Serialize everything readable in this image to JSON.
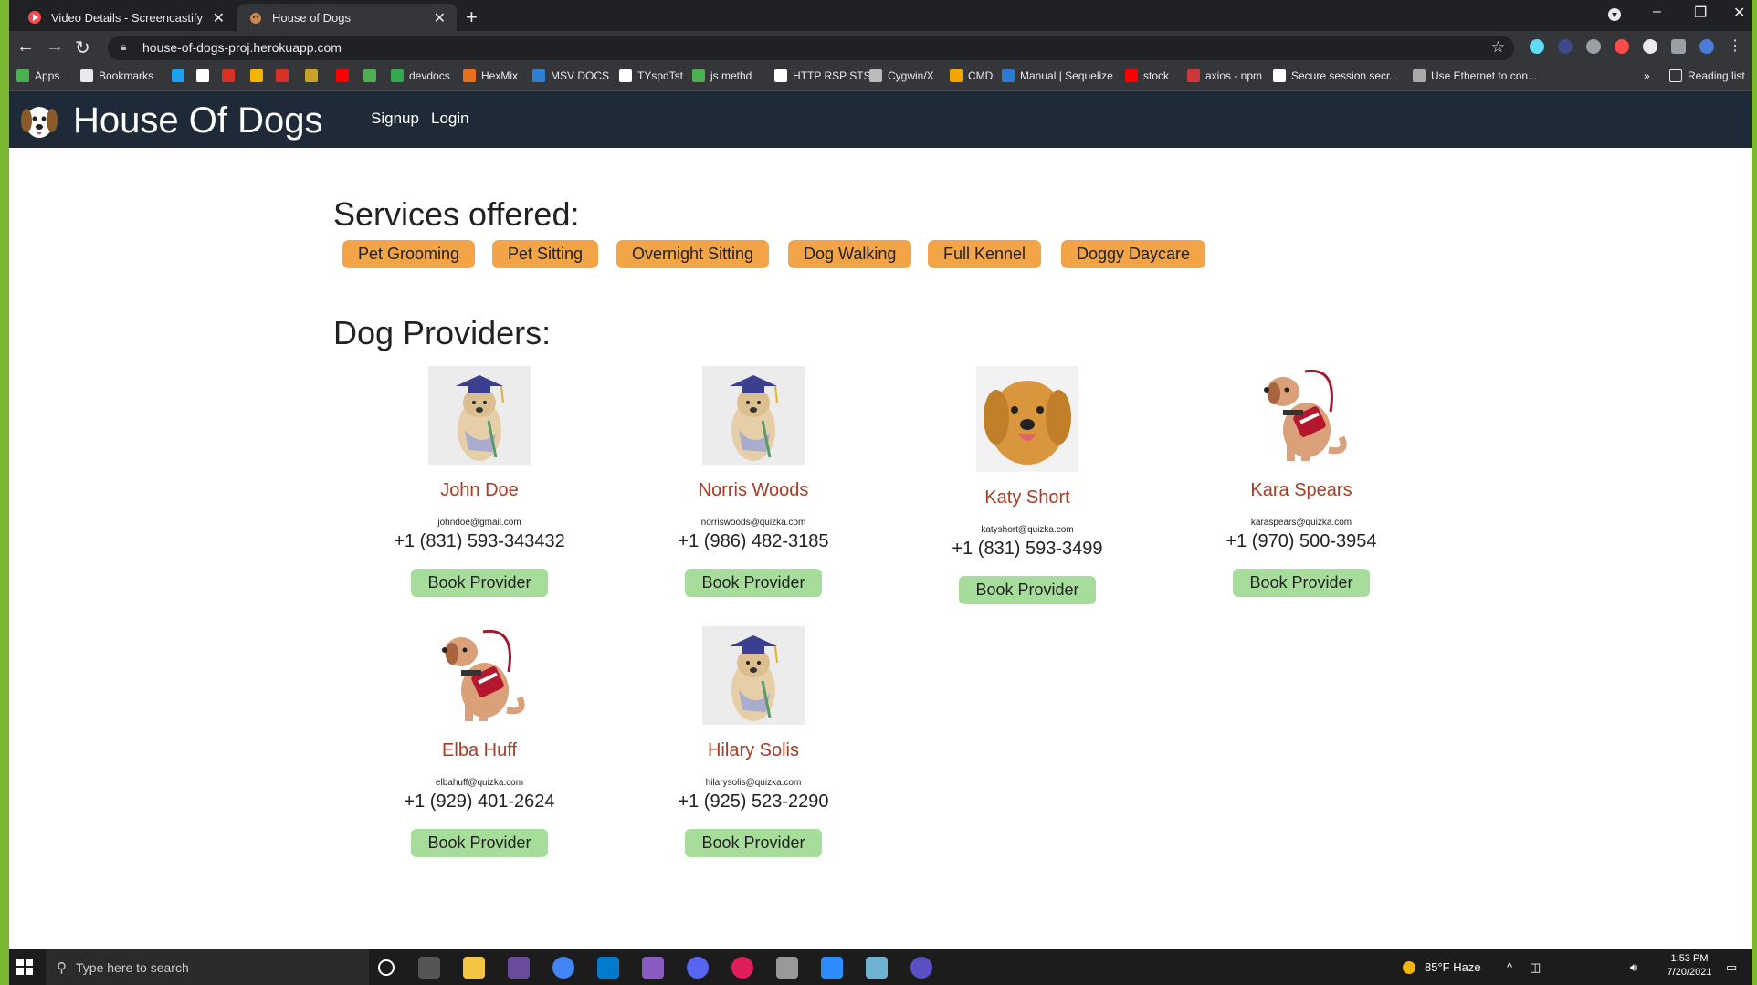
{
  "browser": {
    "tabs": [
      {
        "title": "Video Details - Screencastify",
        "close": "✕"
      },
      {
        "title": "House of Dogs",
        "close": "✕"
      }
    ],
    "new_tab": "+",
    "window_controls": {
      "minimize": "–",
      "restore": "❐",
      "close": "✕"
    },
    "url": "house-of-dogs-proj.herokuapp.com",
    "bookmarks": [
      {
        "label": "Apps",
        "color": "#4caf50"
      },
      {
        "label": "Bookmarks",
        "color": "#e8eaed"
      },
      {
        "label": "",
        "color": "#1da1f2"
      },
      {
        "label": "",
        "color": "#ffffff"
      },
      {
        "label": "",
        "color": "#d93025"
      },
      {
        "label": "",
        "color": "#f4b400"
      },
      {
        "label": "",
        "color": "#d93025"
      },
      {
        "label": "",
        "color": "#c9a227"
      },
      {
        "label": "",
        "color": "#ff0000"
      },
      {
        "label": "",
        "color": "#4caf50"
      },
      {
        "label": "devdocs",
        "color": "#34a853"
      },
      {
        "label": "HexMix",
        "color": "#e8711a"
      },
      {
        "label": "MSV DOCS",
        "color": "#2d7fd3"
      },
      {
        "label": "TYspdTst",
        "color": "#ffffff"
      },
      {
        "label": "js methd",
        "color": "#4caf50"
      },
      {
        "label": "HTTP RSP STS",
        "color": "#ffffff"
      },
      {
        "label": "Cygwin/X",
        "color": "#bbbbbb"
      },
      {
        "label": "CMD",
        "color": "#f4a300"
      },
      {
        "label": "Manual | Sequelize",
        "color": "#2b7bd3"
      },
      {
        "label": "stock",
        "color": "#ff0000"
      },
      {
        "label": "axios - npm",
        "color": "#cb3837"
      },
      {
        "label": "Secure session secr...",
        "color": "#ffffff"
      },
      {
        "label": "Use Ethernet to con...",
        "color": "#aaaaaa"
      }
    ],
    "bookmarks_more": "»",
    "reading_list": "Reading list"
  },
  "site": {
    "brand": "House Of Dogs",
    "nav": [
      {
        "label": "Signup"
      },
      {
        "label": "Login"
      }
    ],
    "services_title": "Services offered:",
    "services": [
      "Pet Grooming",
      "Pet Sitting",
      "Overnight Sitting",
      "Dog Walking",
      "Full Kennel",
      "Doggy Daycare"
    ],
    "providers_title": "Dog Providers:",
    "providers": [
      {
        "name": "John Doe",
        "email": "johndoe@gmail.com",
        "phone": "+1 (831) 593-343432",
        "image": "grad-dog",
        "book": "Book Provider"
      },
      {
        "name": "Norris Woods",
        "email": "norriswoods@quizka.com",
        "phone": "+1 (986) 482-3185",
        "image": "grad-dog",
        "book": "Book Provider"
      },
      {
        "name": "Katy Short",
        "email": "katyshort@quizka.com",
        "phone": "+1 (831) 593-3499",
        "image": "golden-retriever",
        "book": "Book Provider"
      },
      {
        "name": "Kara Spears",
        "email": "karaspears@quizka.com",
        "phone": "+1 (970) 500-3954",
        "image": "service-dog",
        "book": "Book Provider"
      },
      {
        "name": "Elba Huff",
        "email": "elbahuff@quizka.com",
        "phone": "+1 (929) 401-2624",
        "image": "service-dog",
        "book": "Book Provider"
      },
      {
        "name": "Hilary Solis",
        "email": "hilarysolis@quizka.com",
        "phone": "+1 (925) 523-2290",
        "image": "grad-dog",
        "book": "Book Provider"
      }
    ]
  },
  "taskbar": {
    "search_placeholder": "Type here to search",
    "weather": "85°F Haze",
    "time": "1:53 PM",
    "date": "7/20/2021"
  },
  "colors": {
    "navbar": "#1e2a38",
    "service_button": "#f2a447",
    "book_button": "#a7dd9b",
    "provider_name": "#a83c25"
  }
}
